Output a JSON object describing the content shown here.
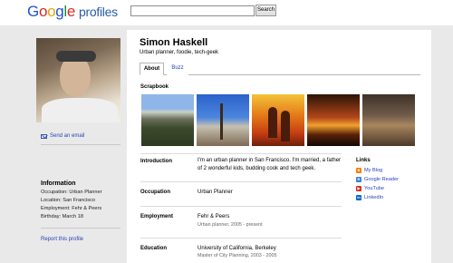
{
  "header": {
    "logo_letters": [
      "G",
      "o",
      "o",
      "g",
      "l",
      "e"
    ],
    "logo_suffix": "profiles",
    "search_placeholder": "",
    "search_button": "Search"
  },
  "sidebar": {
    "send_email": "Send an email",
    "info_title": "Information",
    "info": [
      "Occupation: Urban Planner",
      "Location: San Francisco",
      "Employment: Fehr & Peers",
      "Birthday: March 18"
    ],
    "report": "Report this profile"
  },
  "profile": {
    "name": "Simon Haskell",
    "tagline": "Urban planner, foodie, tech-geek",
    "tabs": [
      {
        "label": "About"
      },
      {
        "label": "Buzz"
      }
    ],
    "scrapbook_title": "Scrapbook",
    "rows": [
      {
        "label": "Introduction",
        "value": "I'm an urban planner in San Francisco. I'm married, a father of 2 wonderful kids, budding cook and tech geek.",
        "sub": ""
      },
      {
        "label": "Occupation",
        "value": "Urban Planner",
        "sub": ""
      },
      {
        "label": "Employment",
        "value": "Fehr & Peers",
        "sub": "Urban planner, 2005 - present"
      },
      {
        "label": "Education",
        "value": "University of California, Berkeley",
        "sub": "Master of City Planning, 2003 - 2005"
      }
    ],
    "links_title": "Links",
    "links": [
      {
        "label": "My Blog",
        "icon": "blogger-icon",
        "color": "#f57d00"
      },
      {
        "label": "Google Reader",
        "icon": "google-reader-icon",
        "color": "#3f7fd6"
      },
      {
        "label": "YouTube",
        "icon": "youtube-icon",
        "color": "#d62b23"
      },
      {
        "label": "LinkedIn",
        "icon": "linkedin-icon",
        "color": "#0a66c2"
      }
    ]
  },
  "colors": {
    "link": "#2a43b8",
    "background": "#e9e9e9"
  }
}
